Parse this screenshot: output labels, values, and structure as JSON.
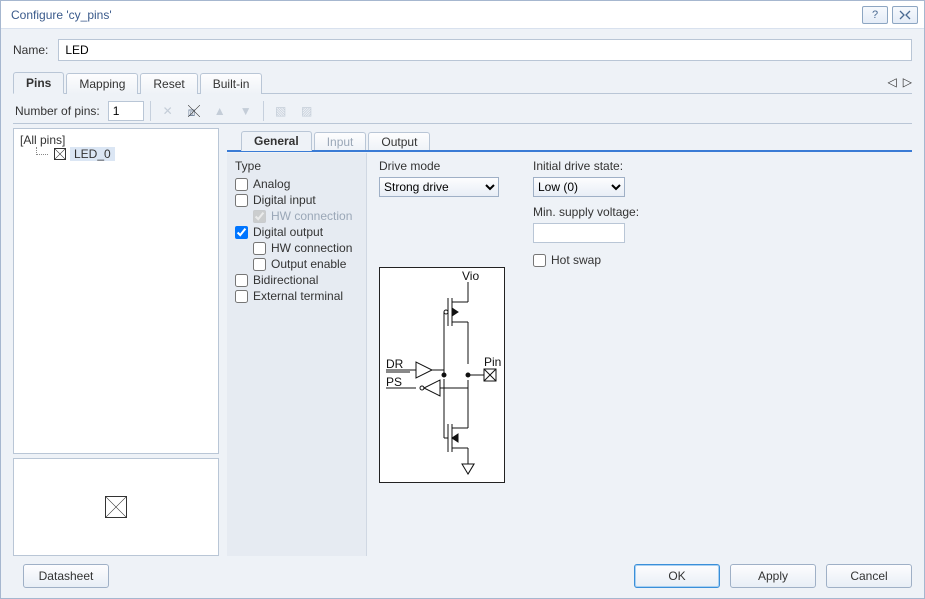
{
  "window": {
    "title": "Configure 'cy_pins'"
  },
  "name_field": {
    "label": "Name:",
    "value": "LED"
  },
  "main_tabs": [
    "Pins",
    "Mapping",
    "Reset",
    "Built-in"
  ],
  "toolbar": {
    "label": "Number of pins:",
    "value": "1"
  },
  "tree": {
    "root": "[All pins]",
    "items": [
      "LED_0"
    ]
  },
  "inner_tabs": [
    "General",
    "Input",
    "Output"
  ],
  "type": {
    "title": "Type",
    "analog": "Analog",
    "digital_input": "Digital input",
    "hw_conn_in": "HW connection",
    "hw_conn_in_checked": true,
    "digital_output": "Digital output",
    "digital_output_checked": true,
    "hw_conn_out": "HW connection",
    "output_enable": "Output enable",
    "bidirectional": "Bidirectional",
    "external_terminal": "External terminal"
  },
  "drive": {
    "title": "Drive mode",
    "value": "Strong drive"
  },
  "state": {
    "init_label": "Initial drive state:",
    "init_value": "Low (0)",
    "min_supply_label": "Min. supply voltage:",
    "min_supply_value": "",
    "hot_swap": "Hot swap"
  },
  "buttons": {
    "datasheet": "Datasheet",
    "ok": "OK",
    "apply": "Apply",
    "cancel": "Cancel"
  },
  "diagram_labels": {
    "vio": "Vio",
    "dr": "DR",
    "ps": "PS",
    "pin": "Pin"
  }
}
